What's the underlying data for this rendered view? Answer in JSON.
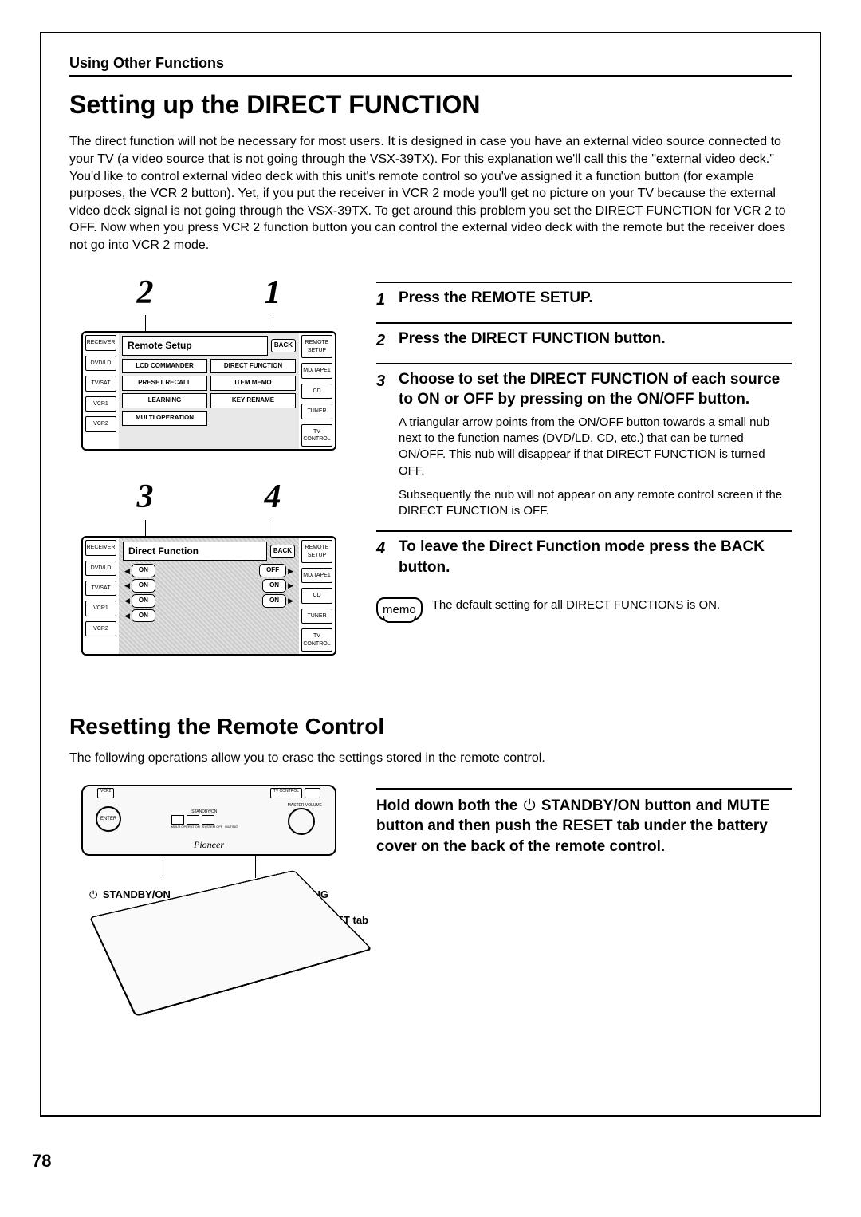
{
  "section_header": "Using Other Functions",
  "title": "Setting up the DIRECT FUNCTION",
  "intro": "The direct function will not be necessary for most users. It is designed in case you have an external video source connected to your TV (a video source that is not going through the VSX-39TX). For this explanation we'll call this the \"external video deck.\" You'd like to control external video deck with this unit's remote control so you've assigned it a function button (for example purposes, the VCR 2 button). Yet, if you put the receiver in VCR 2 mode you'll get no picture on your TV because the external video deck signal is not going through the VSX-39TX. To get around this problem you set the DIRECT FUNCTION for VCR 2 to OFF. Now when you press VCR 2 function button you can control the external video deck with the remote but the receiver does not go into VCR 2 mode.",
  "callout_nums_top": {
    "a": "2",
    "b": "1"
  },
  "callout_nums_mid": {
    "a": "3",
    "b": "4"
  },
  "lcd1": {
    "title": "Remote Setup",
    "back": "BACK",
    "left": [
      "RECEIVER",
      "DVD/LD",
      "TV/SAT",
      "VCR1",
      "VCR2"
    ],
    "right": [
      "REMOTE SETUP",
      "MD/TAPE1",
      "CD",
      "TUNER",
      "TV CONTROL"
    ],
    "grid": [
      "LCD COMMANDER",
      "DIRECT FUNCTION",
      "PRESET RECALL",
      "ITEM MEMO",
      "LEARNING",
      "KEY RENAME",
      "MULTI OPERATION"
    ]
  },
  "lcd2": {
    "title": "Direct Function",
    "back": "BACK",
    "left": [
      "RECEIVER",
      "DVD/LD",
      "TV/SAT",
      "VCR1",
      "VCR2"
    ],
    "right": [
      "REMOTE SETUP",
      "MD/TAPE1",
      "CD",
      "TUNER",
      "TV CONTROL"
    ],
    "rows": [
      {
        "l": "ON",
        "r": "OFF"
      },
      {
        "l": "ON",
        "r": "ON"
      },
      {
        "l": "ON",
        "r": "ON"
      },
      {
        "l": "ON",
        "r": ""
      }
    ]
  },
  "steps": {
    "s1": {
      "num": "1",
      "title": "Press the REMOTE SETUP."
    },
    "s2": {
      "num": "2",
      "title": "Press the DIRECT FUNCTION button."
    },
    "s3": {
      "num": "3",
      "title": "Choose to set the DIRECT FUNCTION of each source to ON or OFF by pressing on the ON/OFF button.",
      "body1": "A triangular arrow points from the ON/OFF button towards a small nub next to the function names (DVD/LD, CD, etc.) that can be turned ON/OFF. This nub will disappear if that DIRECT FUNCTION is turned OFF.",
      "body2": "Subsequently the nub will not appear on any remote control screen if the DIRECT FUNCTION is OFF."
    },
    "s4": {
      "num": "4",
      "title": "To leave the Direct Function mode press the BACK button."
    }
  },
  "memo": {
    "label": "memo",
    "text": "The default setting for all DIRECT FUNCTIONS is ON."
  },
  "reset": {
    "title": "Resetting the Remote Control",
    "intro": "The following operations allow you to erase the settings stored in the remote control.",
    "hold": {
      "pre": "Hold down both the ",
      "standby": " STANDBY/ON button and MUTE button and then push the RESET tab under the battery cover on the back of the remote control."
    }
  },
  "remote_illus": {
    "brand": "Pioneer",
    "top_left": "VCR2",
    "top_right": "TV CONTROL",
    "dpad": "ENTER",
    "mid_labels": [
      "MULTI OPERATION",
      "SYSTEM OFF",
      "MUTING"
    ],
    "vol_label": "MASTER VOLUME",
    "standby_label": "STANDBY/ON",
    "bottom_left": " STANDBY/ON",
    "bottom_right": "MUTING",
    "reset_tab": "RESET tab"
  },
  "page_number": "78"
}
